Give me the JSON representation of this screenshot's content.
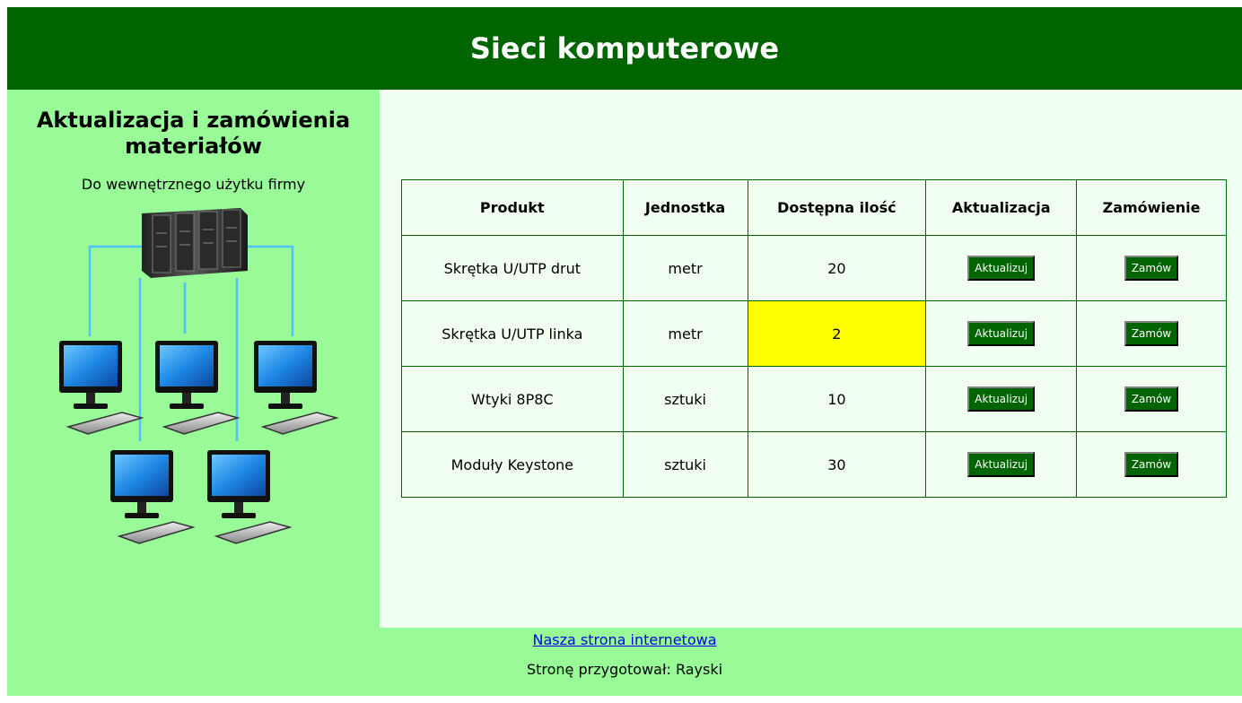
{
  "header": {
    "title": "Sieci komputerowe"
  },
  "sidebar": {
    "title": "Aktualizacja i zamówienia materiałów",
    "subtitle": "Do wewnętrznego użytku firmy",
    "image": "network-illustration"
  },
  "table": {
    "headers": [
      "Produkt",
      "Jednostka",
      "Dostępna ilość",
      "Aktualizacja",
      "Zamówienie"
    ],
    "rows": [
      {
        "product": "Skrętka U/UTP drut",
        "unit": "metr",
        "quantity": "20",
        "update_label": "Aktualizuj",
        "order_label": "Zamów"
      },
      {
        "product": "Skrętka U/UTP linka",
        "unit": "metr",
        "quantity": "2",
        "update_label": "Aktualizuj",
        "order_label": "Zamów",
        "highlight": "#ffff00"
      },
      {
        "product": "Wtyki 8P8C",
        "unit": "sztuki",
        "quantity": "10",
        "update_label": "Aktualizuj",
        "order_label": "Zamów"
      },
      {
        "product": "Moduły Keystone",
        "unit": "sztuki",
        "quantity": "30",
        "update_label": "Aktualizuj",
        "order_label": "Zamów"
      }
    ]
  },
  "footer": {
    "link_text": "Nasza strona internetowa",
    "credit": "Stronę przygotował: Rayski"
  },
  "colors": {
    "header_bg": "#006400",
    "sidebar_bg": "#98fb98",
    "main_bg": "#f0fff0",
    "button_bg": "#006400",
    "low_stock": "#ffff00"
  }
}
